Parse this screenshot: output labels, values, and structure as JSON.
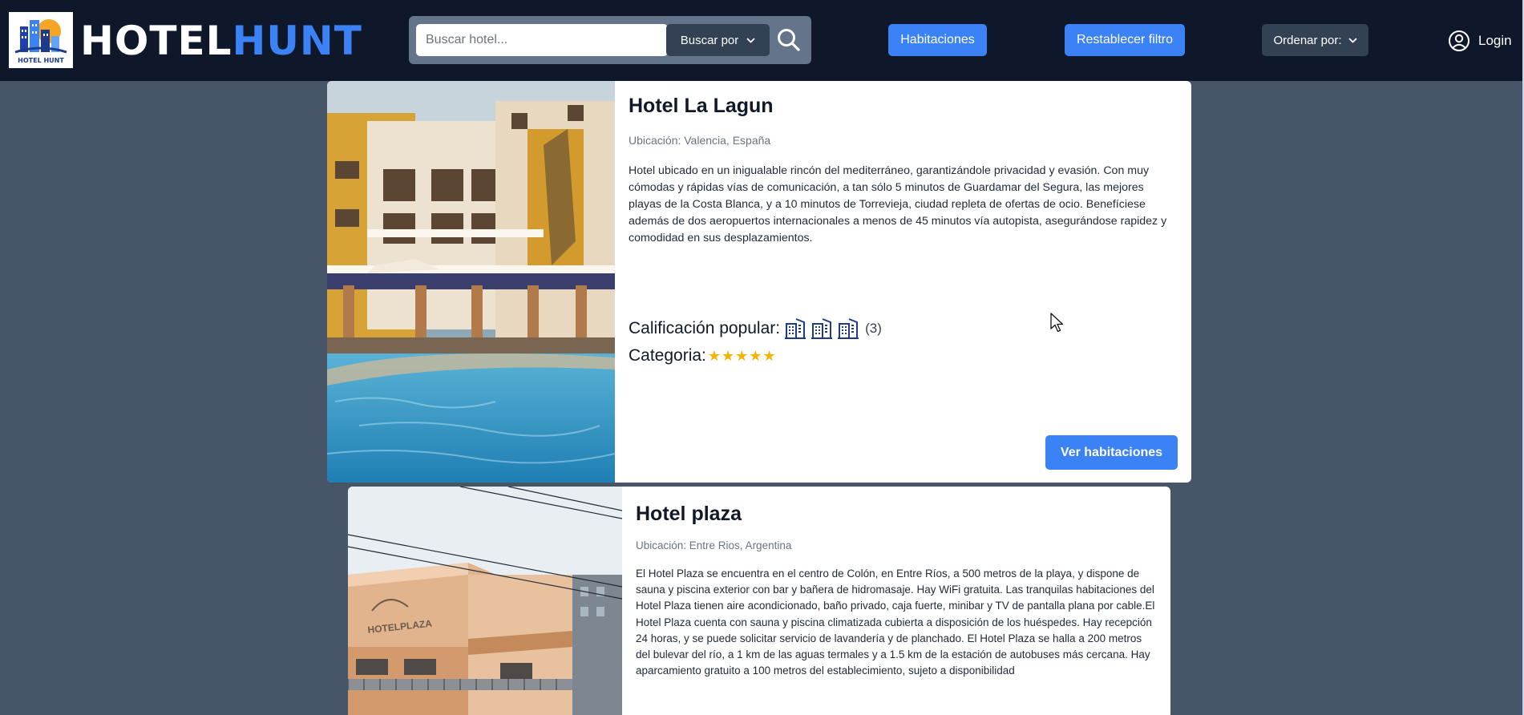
{
  "navbar": {
    "logo_caption": "HOTEL HUNT",
    "brand_white": "HOTEL",
    "brand_blue": "HUNT",
    "search_placeholder": "Buscar hotel...",
    "search_by_label": "Buscar por",
    "rooms_label": "Habitaciones",
    "reset_filter_label": "Restablecer filtro",
    "order_by_label": "Ordenar por:",
    "login_label": "Login"
  },
  "hotels": [
    {
      "name": "Hotel La Lagun",
      "location": "Ubicación: Valencia, España",
      "description": "Hotel ubicado en un inigualable rincón del mediterráneo, garantizándole privacidad y evasión. Con muy cómodas y rápidas vías de comunicación, a tan sólo 5 minutos de Guardamar del Segura, las mejores playas de la Costa Blanca, y a 10 minutos de Torrevieja, ciudad repleta de ofertas de ocio. Benefíciese además de dos aeropuertos internacionales a menos de 45 minutos vía autopista, asegurándose rapidez y comodidad en sus desplazamientos.",
      "rating_label": "Calificación popular:",
      "rating_value": 3,
      "rating_count": "(3)",
      "category_label": "Categoria:",
      "category_stars": "★★★★★",
      "button_label": "Ver habitaciones"
    },
    {
      "name": "Hotel plaza",
      "location": "Ubicación: Entre Rios, Argentina",
      "description": "El Hotel Plaza se encuentra en el centro de Colón, en Entre Ríos, a 500 metros de la playa, y dispone de sauna y piscina exterior con bar y bañera de hidromasaje. Hay WiFi gratuita. Las tranquilas habitaciones del Hotel Plaza tienen aire acondicionado, baño privado, caja fuerte, minibar y TV de pantalla plana por cable.El Hotel Plaza cuenta con sauna y piscina climatizada cubierta a disposición de los huéspedes. Hay recepción 24 horas, y se puede solicitar servicio de lavandería y de planchado. El Hotel Plaza se halla a 200 metros del bulevar del río, a 1 km de las aguas termales y a 1.5 km de la estación de autobuses más cercana. Hay aparcamiento gratuito a 100 metros del establecimiento, sujeto a disponibilidad",
      "hotel_sign": "HOTELPLAZA"
    }
  ],
  "icons": {
    "search": "search-icon",
    "chevron": "chevron-down-icon",
    "user": "user-circle-icon",
    "rating": "building-icon",
    "cursor": "mouse-cursor-icon"
  },
  "colors": {
    "navbar_bg": "#0f172a",
    "page_bg": "#475569",
    "accent": "#3b82f6",
    "star": "#f5b301",
    "rating_icon": "#1e3a8a"
  }
}
